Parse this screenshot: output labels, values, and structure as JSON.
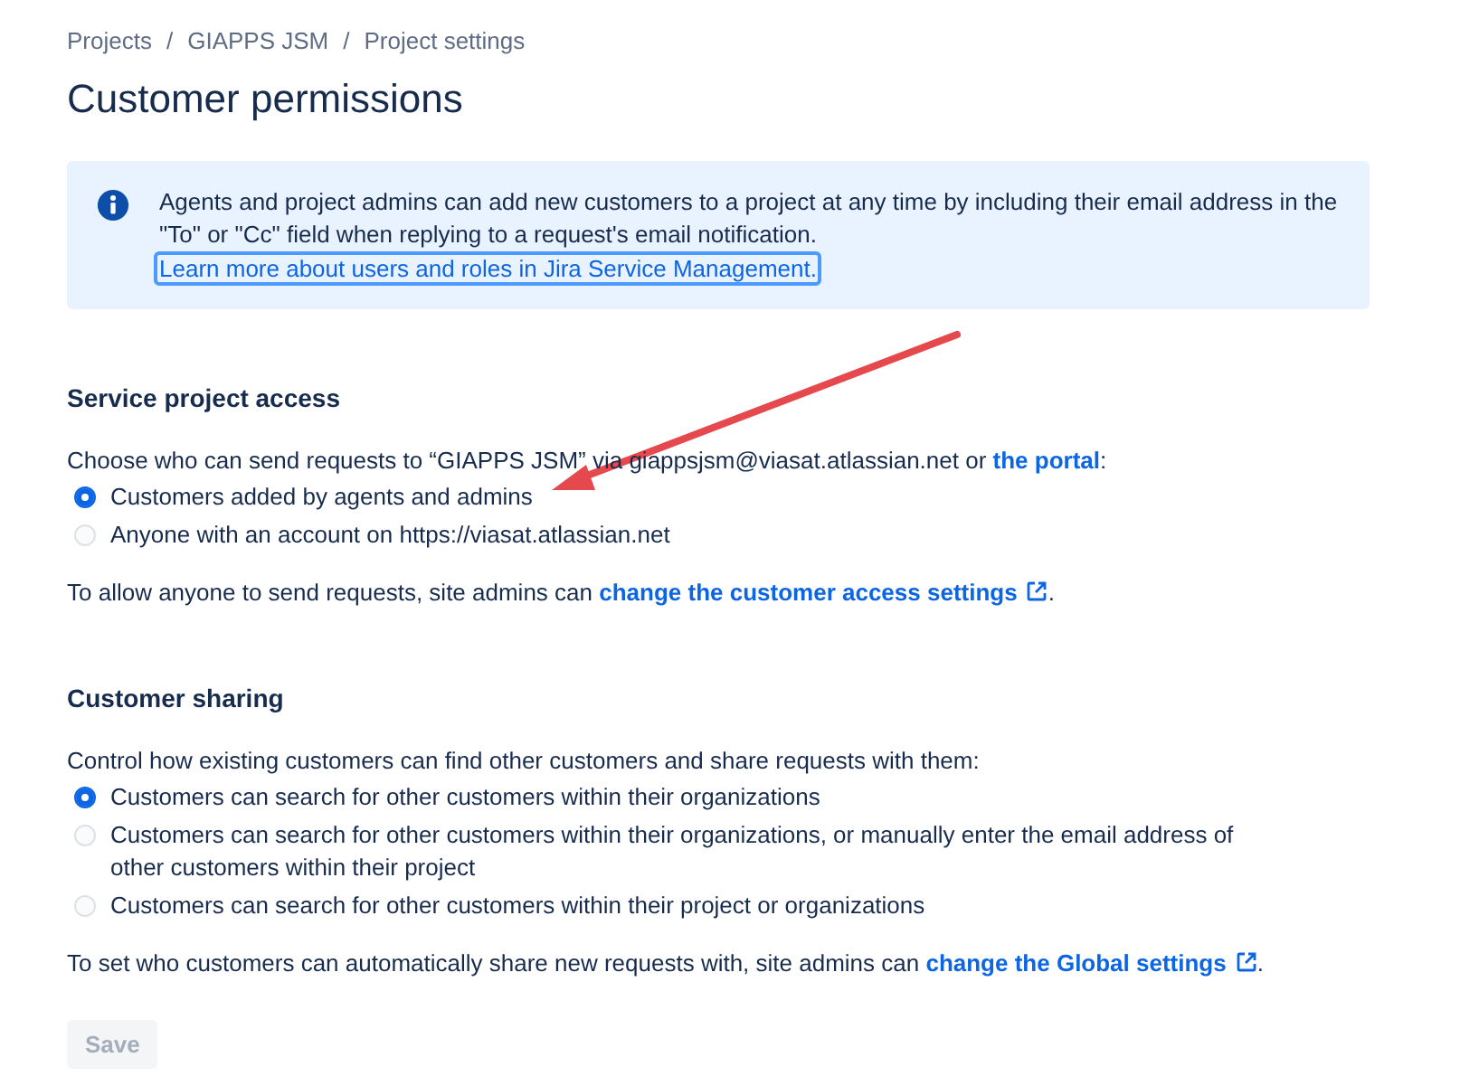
{
  "breadcrumbs": [
    "Projects",
    "GIAPPS JSM",
    "Project settings"
  ],
  "breadcrumb_separator": "/",
  "title": "Customer permissions",
  "info_banner": {
    "text": "Agents and project admins can add new customers to a project at any time by including their email address in the \"To\" or \"Cc\" field when replying to a request's email notification.",
    "link": "Learn more about users and roles in Jira Service Management."
  },
  "sections": [
    {
      "heading": "Service project access",
      "intro": "Choose who can send requests to “GIAPPS JSM” via giappsjsm@viasat.atlassian.net or ",
      "intro_link": "the portal",
      "intro_end": ":",
      "options": [
        {
          "label": "Customers added by agents and admins",
          "selected": true
        },
        {
          "label": "Anyone with an account on https://viasat.atlassian.net",
          "selected": false
        }
      ],
      "footer": "To allow anyone to send requests, site admins can ",
      "footer_link": "change the customer access settings",
      "footer_end": "."
    },
    {
      "heading": "Customer sharing",
      "intro": "Control how existing customers can find other customers and share requests with them:",
      "options": [
        {
          "label": "Customers can search for other customers within their organizations",
          "selected": true
        },
        {
          "label": "Customers can search for other customers within their organizations, or manually enter the email address of other customers within their project",
          "selected": false
        },
        {
          "label": "Customers can search for other customers within their project or organizations",
          "selected": false
        }
      ],
      "footer": "To set who customers can automatically share new requests with, site admins can ",
      "footer_link": "change the Global settings",
      "footer_end": "."
    }
  ],
  "save_button": {
    "label": "Save",
    "disabled": true
  }
}
